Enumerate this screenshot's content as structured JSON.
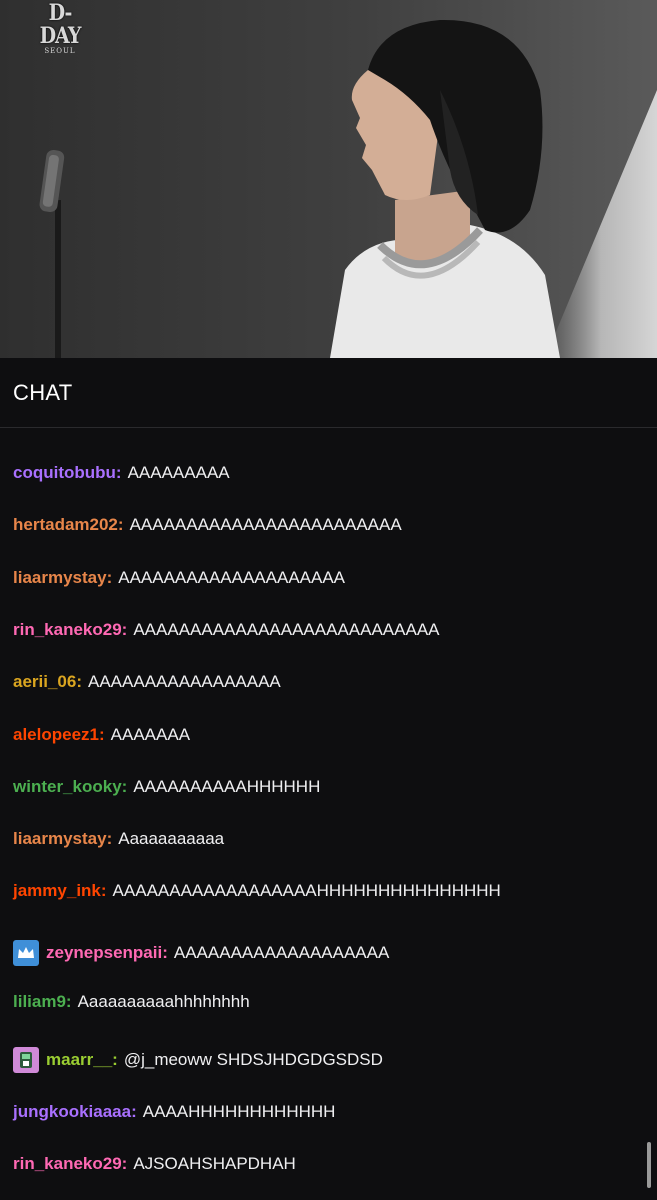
{
  "video": {
    "logo_big": "D-DAY",
    "logo_small": "SEOUL"
  },
  "chat": {
    "title": "CHAT",
    "messages": [
      {
        "user": "coquitobubu:",
        "text": "AAAAAAAAA",
        "color": "#a970ff"
      },
      {
        "user": "hertadam202:",
        "text": "AAAAAAAAAAAAAAAAAAAAAAAA",
        "color": "#e8864a"
      },
      {
        "user": "liaarmystay:",
        "text": "AAAAAAAAAAAAAAAAAAAA",
        "color": "#e8864a"
      },
      {
        "user": "rin_kaneko29:",
        "text": "AAAAAAAAAAAAAAAAAAAAAAAAAAA",
        "color": "#ff69b4"
      },
      {
        "user": "aerii_06:",
        "text": "AAAAAAAAAAAAAAAAA",
        "color": "#daa520"
      },
      {
        "user": "alelopeez1:",
        "text": "AAAAAAA",
        "color": "#ff4500"
      },
      {
        "user": "winter_kooky:",
        "text": "AAAAAAAAAAHHHHHH",
        "color": "#4caf50"
      },
      {
        "user": "liaarmystay:",
        "text": "Aaaaaaaaaaa",
        "color": "#e8864a"
      },
      {
        "user": "jammy_ink:",
        "text": "AAAAAAAAAAAAAAAAAAHHHHHHHHHHHHHHH",
        "color": "#ff4500"
      },
      {
        "user": "zeynepsenpaii:",
        "text": "AAAAAAAAAAAAAAAAAAA",
        "color": "#ff69b4",
        "badge": "crown"
      },
      {
        "user": "liliam9:",
        "text": "Aaaaaaaaaahhhhhhhh",
        "color": "#4caf50"
      },
      {
        "user": "maarr__:",
        "text": "@j_meoww SHDSJHDGDGSDSD",
        "color": "#9acd32",
        "badge": "sub"
      },
      {
        "user": "jungkookiaaaa:",
        "text": "AAAAHHHHHHHHHHHH",
        "color": "#a970ff"
      },
      {
        "user": "rin_kaneko29:",
        "text": "AJSOAHSHAPDHAH",
        "color": "#ff69b4"
      }
    ]
  },
  "icons": {
    "crown_badge": "crown-icon",
    "sub_badge": "subscriber-badge-icon"
  }
}
